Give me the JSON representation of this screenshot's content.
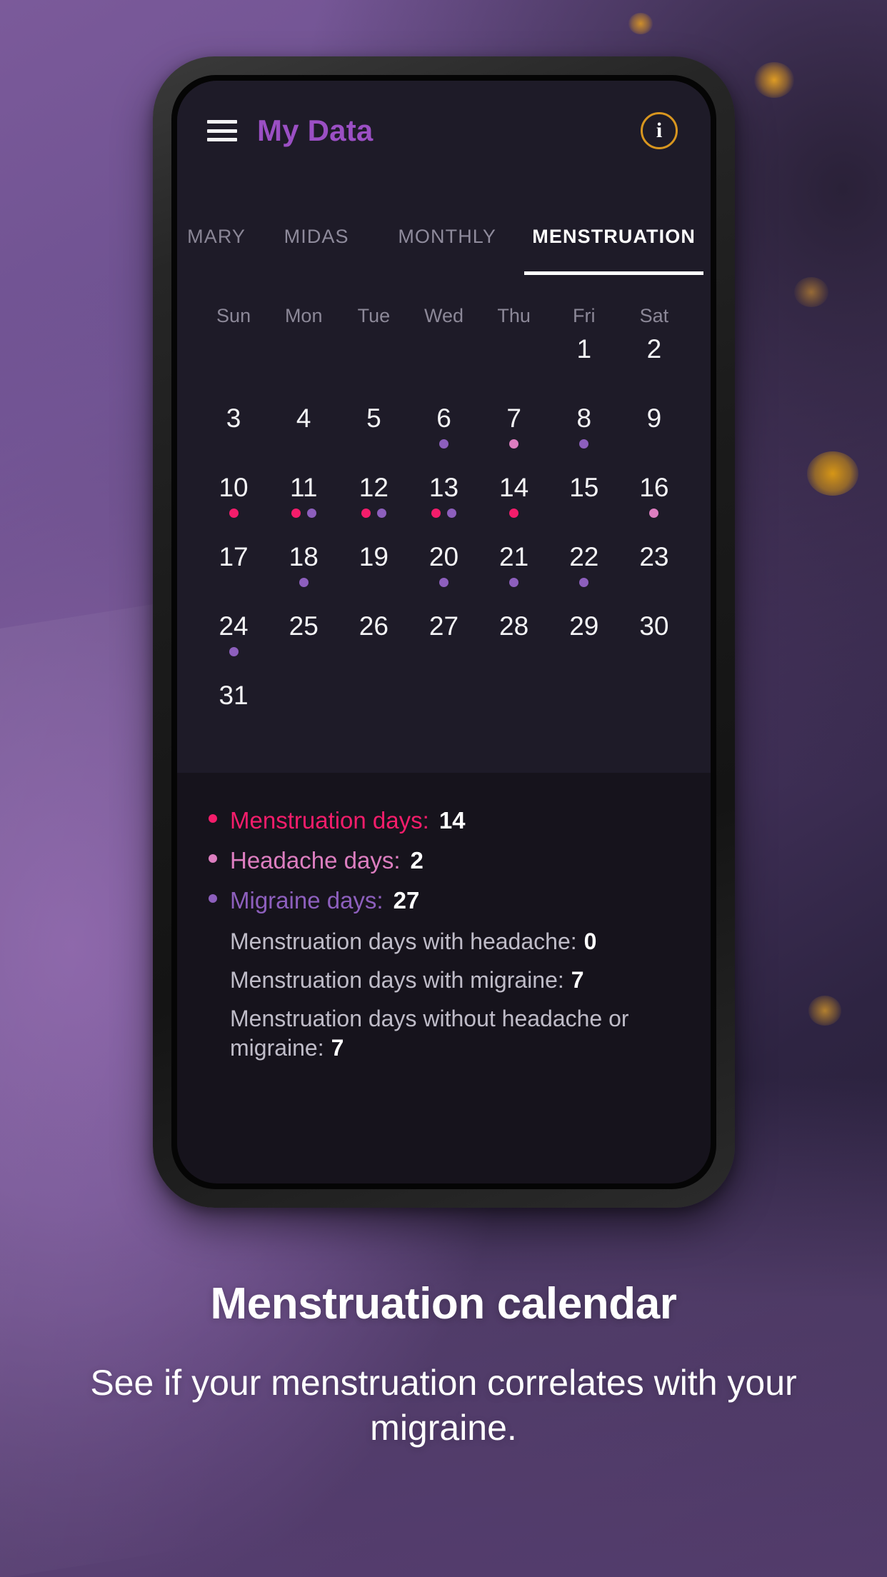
{
  "appbar": {
    "menu_icon": "hamburger-menu-icon",
    "title": "My Data",
    "info_icon": "info-icon",
    "info_label": "i"
  },
  "tabs": [
    {
      "label": "MARY",
      "active": false
    },
    {
      "label": "MIDAS",
      "active": false
    },
    {
      "label": "MONTHLY",
      "active": false
    },
    {
      "label": "MENSTRUATION",
      "active": true
    }
  ],
  "calendar": {
    "weekdays": [
      "Sun",
      "Mon",
      "Tue",
      "Wed",
      "Thu",
      "Fri",
      "Sat"
    ],
    "weeks": [
      [
        {
          "day": "",
          "dots": []
        },
        {
          "day": "",
          "dots": []
        },
        {
          "day": "",
          "dots": []
        },
        {
          "day": "",
          "dots": []
        },
        {
          "day": "",
          "dots": []
        },
        {
          "day": "1",
          "dots": []
        },
        {
          "day": "2",
          "dots": []
        }
      ],
      [
        {
          "day": "3",
          "dots": []
        },
        {
          "day": "4",
          "dots": []
        },
        {
          "day": "5",
          "dots": []
        },
        {
          "day": "6",
          "dots": [
            "g"
          ]
        },
        {
          "day": "7",
          "dots": [
            "h"
          ]
        },
        {
          "day": "8",
          "dots": [
            "g"
          ]
        },
        {
          "day": "9",
          "dots": []
        }
      ],
      [
        {
          "day": "10",
          "dots": [
            "m"
          ]
        },
        {
          "day": "11",
          "dots": [
            "m",
            "g"
          ]
        },
        {
          "day": "12",
          "dots": [
            "m",
            "g"
          ]
        },
        {
          "day": "13",
          "dots": [
            "m",
            "g"
          ]
        },
        {
          "day": "14",
          "dots": [
            "m"
          ]
        },
        {
          "day": "15",
          "dots": []
        },
        {
          "day": "16",
          "dots": [
            "h"
          ]
        }
      ],
      [
        {
          "day": "17",
          "dots": []
        },
        {
          "day": "18",
          "dots": [
            "g"
          ]
        },
        {
          "day": "19",
          "dots": []
        },
        {
          "day": "20",
          "dots": [
            "g"
          ]
        },
        {
          "day": "21",
          "dots": [
            "g"
          ]
        },
        {
          "day": "22",
          "dots": [
            "g"
          ]
        },
        {
          "day": "23",
          "dots": []
        }
      ],
      [
        {
          "day": "24",
          "dots": [
            "g"
          ]
        },
        {
          "day": "25",
          "dots": []
        },
        {
          "day": "26",
          "dots": []
        },
        {
          "day": "27",
          "dots": []
        },
        {
          "day": "28",
          "dots": []
        },
        {
          "day": "29",
          "dots": []
        },
        {
          "day": "30",
          "dots": []
        }
      ],
      [
        {
          "day": "31",
          "dots": []
        },
        {
          "day": "",
          "dots": []
        },
        {
          "day": "",
          "dots": []
        },
        {
          "day": "",
          "dots": []
        },
        {
          "day": "",
          "dots": []
        },
        {
          "day": "",
          "dots": []
        },
        {
          "day": "",
          "dots": []
        }
      ]
    ]
  },
  "stats": {
    "legend": [
      {
        "key": "m",
        "label": "Menstruation days:",
        "value": "14",
        "color": "#f41d6b"
      },
      {
        "key": "h",
        "label": "Headache days:",
        "value": "2",
        "color": "#dd7ec0"
      },
      {
        "key": "g",
        "label": "Migraine days:",
        "value": "27",
        "color": "#8d5fbd"
      }
    ],
    "rows": [
      {
        "label": "Menstruation days with headache:",
        "value": "0"
      },
      {
        "label": "Menstruation days with migraine:",
        "value": "7"
      },
      {
        "label": "Menstruation days without headache or migraine:",
        "value": "7"
      }
    ]
  },
  "caption": {
    "title": "Menstruation calendar",
    "subtitle": "See if your menstruation correlates with your migraine."
  }
}
